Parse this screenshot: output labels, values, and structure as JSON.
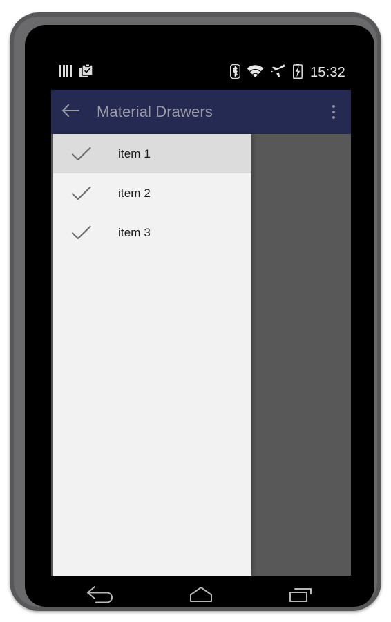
{
  "device": {
    "frame_color": "#58585a",
    "screen_background": "#000000"
  },
  "status_bar": {
    "background": "#000000",
    "clock": "15:32",
    "left_icons": [
      {
        "name": "sim-bars-icon",
        "label": "signal bars"
      },
      {
        "name": "clipboard-check-icon",
        "label": "clipboard"
      }
    ],
    "right_icons": [
      {
        "name": "bluetooth-icon",
        "label": "Bluetooth"
      },
      {
        "name": "wifi-icon",
        "label": "Wi-Fi"
      },
      {
        "name": "airplane-mode-icon",
        "label": "Airplane mode"
      },
      {
        "name": "battery-charging-icon",
        "label": "Battery charging"
      }
    ]
  },
  "app_bar": {
    "background": "#242a52",
    "title": "Material Drawers",
    "title_color": "#9b9ba6",
    "back_icon": "arrow-back-icon",
    "overflow_icon": "overflow-menu-icon"
  },
  "drawer": {
    "background": "#f2f2f2",
    "selected_background": "#dcdcdc",
    "scrim_color": "#585858",
    "items": [
      {
        "label": "item 1",
        "icon": "check-icon",
        "selected": true
      },
      {
        "label": "item 2",
        "icon": "check-icon",
        "selected": false
      },
      {
        "label": "item 3",
        "icon": "check-icon",
        "selected": false
      }
    ]
  },
  "navigation_bar": {
    "background": "#000000",
    "buttons": [
      {
        "name": "back-nav-button",
        "icon": "back-arrow-icon",
        "label": "Back"
      },
      {
        "name": "home-nav-button",
        "icon": "home-icon",
        "label": "Home"
      },
      {
        "name": "recents-nav-button",
        "icon": "recents-icon",
        "label": "Recents"
      }
    ]
  }
}
